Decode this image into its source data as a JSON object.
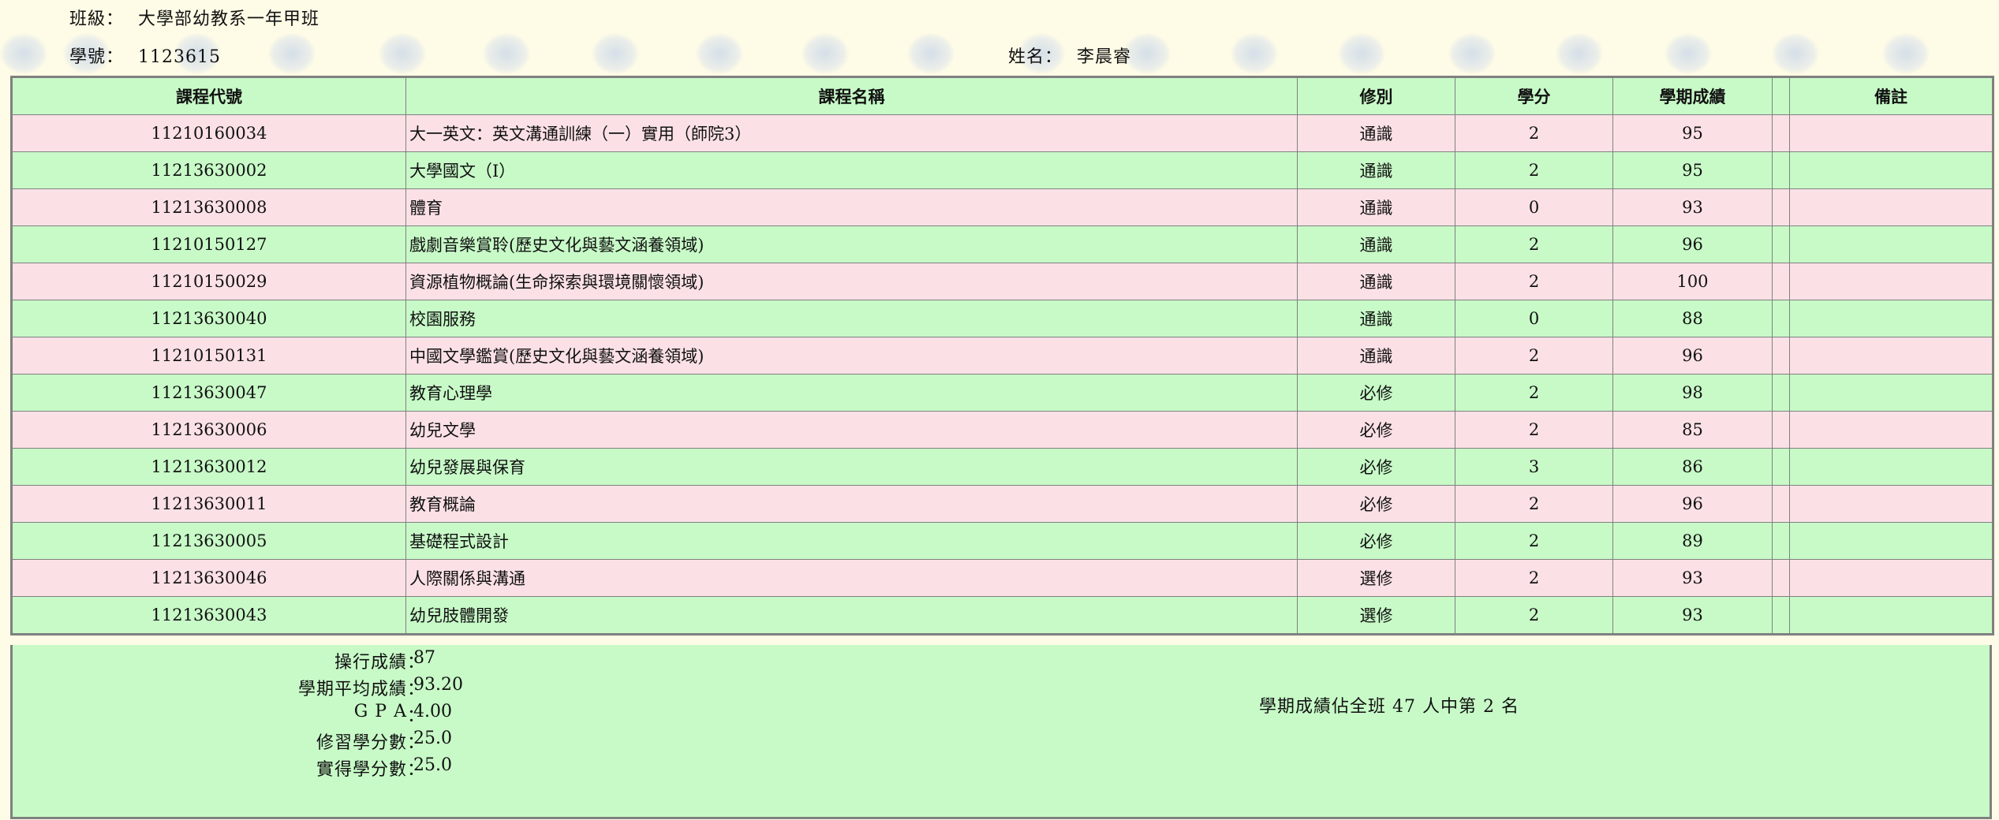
{
  "header": {
    "class_label": "班級：",
    "class_value": "大學部幼教系一年甲班",
    "student_id_label": "學號：",
    "student_id_value": "1123615",
    "name_label": "姓名：",
    "name_value": "李晨睿"
  },
  "table": {
    "columns": [
      "課程代號",
      "課程名稱",
      "修別",
      "學分",
      "學期成績",
      "",
      "備註"
    ],
    "rows": [
      {
        "code": "11210160034",
        "name": "大一英文：英文溝通訓練（一）實用（師院3）",
        "type": "通識",
        "credits": "2",
        "score": "95",
        "extra": "",
        "note": ""
      },
      {
        "code": "11213630002",
        "name": "大學國文（Ⅰ）",
        "type": "通識",
        "credits": "2",
        "score": "95",
        "extra": "",
        "note": ""
      },
      {
        "code": "11213630008",
        "name": "體育",
        "type": "通識",
        "credits": "0",
        "score": "93",
        "extra": "",
        "note": ""
      },
      {
        "code": "11210150127",
        "name": "戲劇音樂賞聆(歷史文化與藝文涵養領域)",
        "type": "通識",
        "credits": "2",
        "score": "96",
        "extra": "",
        "note": ""
      },
      {
        "code": "11210150029",
        "name": "資源植物概論(生命探索與環境關懷領域)",
        "type": "通識",
        "credits": "2",
        "score": "100",
        "extra": "",
        "note": ""
      },
      {
        "code": "11213630040",
        "name": "校園服務",
        "type": "通識",
        "credits": "0",
        "score": "88",
        "extra": "",
        "note": ""
      },
      {
        "code": "11210150131",
        "name": "中國文學鑑賞(歷史文化與藝文涵養領域)",
        "type": "通識",
        "credits": "2",
        "score": "96",
        "extra": "",
        "note": ""
      },
      {
        "code": "11213630047",
        "name": "教育心理學",
        "type": "必修",
        "credits": "2",
        "score": "98",
        "extra": "",
        "note": ""
      },
      {
        "code": "11213630006",
        "name": "幼兒文學",
        "type": "必修",
        "credits": "2",
        "score": "85",
        "extra": "",
        "note": ""
      },
      {
        "code": "11213630012",
        "name": "幼兒發展與保育",
        "type": "必修",
        "credits": "3",
        "score": "86",
        "extra": "",
        "note": ""
      },
      {
        "code": "11213630011",
        "name": "教育概論",
        "type": "必修",
        "credits": "2",
        "score": "96",
        "extra": "",
        "note": ""
      },
      {
        "code": "11213630005",
        "name": "基礎程式設計",
        "type": "必修",
        "credits": "2",
        "score": "89",
        "extra": "",
        "note": ""
      },
      {
        "code": "11213630046",
        "name": "人際關係與溝通",
        "type": "選修",
        "credits": "2",
        "score": "93",
        "extra": "",
        "note": ""
      },
      {
        "code": "11213630043",
        "name": "幼兒肢體開發",
        "type": "選修",
        "credits": "2",
        "score": "93",
        "extra": "",
        "note": ""
      }
    ]
  },
  "summary": {
    "items": [
      {
        "label": "操行成績",
        "value": "87"
      },
      {
        "label": "學期平均成績",
        "value": "93.20"
      },
      {
        "label": "G P A",
        "value": "4.00"
      },
      {
        "label": "修習學分數",
        "value": "25.0"
      },
      {
        "label": "實得學分數",
        "value": "25.0"
      }
    ],
    "separator": "：",
    "rank_text": "學期成績佔全班 47 人中第 2 名"
  },
  "colors": {
    "page_background": "#fefbe6",
    "header_row": "#c8fac8",
    "row_pink": "#fbe1e6",
    "row_green": "#c8fac8",
    "border": "#808080",
    "watermark": "#b4c8eb"
  },
  "icons": {
    "watermark": "school-emblem-watermark-icon"
  }
}
